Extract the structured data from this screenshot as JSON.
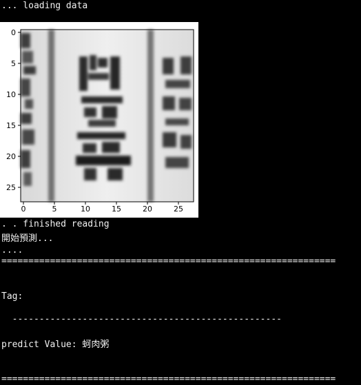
{
  "console": {
    "loading_line": "... loading data",
    "finished_line": ". . finished reading",
    "start_predict_line": "開始預測...",
    "dots_line": "....",
    "rule_top": "==============================================================",
    "tag_label": "Tag:",
    "dash_line": "  --------------------------------------------------",
    "predict_label": "predict Value: ",
    "predict_value": "蚵肉粥",
    "rule_bottom": "=============================================================="
  },
  "image_plot": {
    "x_ticks": [
      "0",
      "5",
      "10",
      "15",
      "20",
      "25"
    ],
    "y_ticks": [
      "0",
      "5",
      "10",
      "15",
      "20",
      "25"
    ],
    "colors": {
      "axes": "#000000",
      "background": "#ffffff"
    }
  }
}
